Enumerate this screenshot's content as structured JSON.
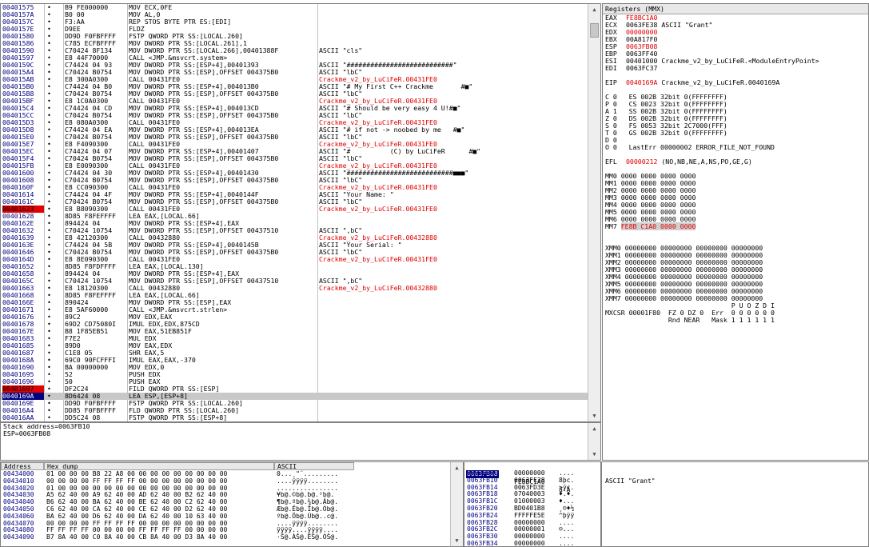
{
  "cpu": {
    "rows": [
      {
        "addr": "00401575",
        "hex": "B9 FE000000",
        "asm": "MOV ECX,0FE",
        "cmt": "",
        "cls": ""
      },
      {
        "addr": "0040157A",
        "hex": "B0 00",
        "asm": "MOV AL,0",
        "cmt": "",
        "cls": ""
      },
      {
        "addr": "0040157C",
        "hex": "F3:AA",
        "asm": "REP STOS BYTE PTR ES:[EDI]",
        "cmt": "",
        "cls": ""
      },
      {
        "addr": "0040157E",
        "hex": "D9EE",
        "asm": "FLDZ",
        "cmt": "",
        "cls": ""
      },
      {
        "addr": "00401580",
        "hex": "DD9D F0FBFFFF",
        "asm": "FSTP QWORD PTR SS:[LOCAL.260]",
        "cmt": "",
        "cls": ""
      },
      {
        "addr": "00401586",
        "hex": "C785 ECFBFFFF",
        "asm": "MOV DWORD PTR SS:[LOCAL.261],1",
        "cmt": "",
        "cls": ""
      },
      {
        "addr": "00401590",
        "hex": "C70424 8F134",
        "asm": "MOV DWORD PTR SS:[LOCAL.266],00401388F",
        "cmt": "ASCII \"cls\"",
        "cls": ""
      },
      {
        "addr": "00401597",
        "hex": "E8 44F70000",
        "asm": "CALL <JMP.&msvcrt.system>",
        "cmt": "",
        "cls": ""
      },
      {
        "addr": "0040159C",
        "hex": "C74424 04 93",
        "asm": "MOV DWORD PTR SS:[ESP+4],00401393",
        "cmt": "ASCII \"###########################\"",
        "cls": ""
      },
      {
        "addr": "004015A4",
        "hex": "C70424 B0754",
        "asm": "MOV DWORD PTR SS:[ESP],OFFSET 004375B0",
        "cmt": "ASCII \"lbC\"",
        "cls": ""
      },
      {
        "addr": "004015AB",
        "hex": "E8 300A0300",
        "asm": "CALL 00431FE0",
        "cmt": "Crackme_v2_by_LuCiFeR.00431FE0",
        "cls": "red"
      },
      {
        "addr": "004015B0",
        "hex": "C74424 04 B0",
        "asm": "MOV DWORD PTR SS:[ESP+4],004013B0",
        "cmt": "ASCII \"# My First C++ Crackme       #■\"",
        "cls": ""
      },
      {
        "addr": "004015B8",
        "hex": "C70424 B0754",
        "asm": "MOV DWORD PTR SS:[ESP],OFFSET 004375B0",
        "cmt": "ASCII \"lbC\"",
        "cls": ""
      },
      {
        "addr": "004015BF",
        "hex": "E8 1C0A0300",
        "asm": "CALL 00431FE0",
        "cmt": "Crackme_v2_by_LuCiFeR.00431FE0",
        "cls": "red"
      },
      {
        "addr": "004015C4",
        "hex": "C74424 04 CD",
        "asm": "MOV DWORD PTR SS:[ESP+4],004013CD",
        "cmt": "ASCII \"# Should be very easy 4 U!#■\"",
        "cls": ""
      },
      {
        "addr": "004015CC",
        "hex": "C70424 B0754",
        "asm": "MOV DWORD PTR SS:[ESP],OFFSET 004375B0",
        "cmt": "ASCII \"lbC\"",
        "cls": ""
      },
      {
        "addr": "004015D3",
        "hex": "E8 080A0300",
        "asm": "CALL 00431FE0",
        "cmt": "Crackme_v2_by_LuCiFeR.00431FE0",
        "cls": "red"
      },
      {
        "addr": "004015D8",
        "hex": "C74424 04 EA",
        "asm": "MOV DWORD PTR SS:[ESP+4],004013EA",
        "cmt": "ASCII \"# if not -> noobed by me   #■\"",
        "cls": ""
      },
      {
        "addr": "004015E0",
        "hex": "C70424 B0754",
        "asm": "MOV DWORD PTR SS:[ESP],OFFSET 004375B0",
        "cmt": "ASCII \"lbC\"",
        "cls": ""
      },
      {
        "addr": "004015E7",
        "hex": "E8 F4090300",
        "asm": "CALL 00431FE0",
        "cmt": "Crackme_v2_by_LuCiFeR.00431FE0",
        "cls": "red"
      },
      {
        "addr": "004015EC",
        "hex": "C74424 04 07",
        "asm": "MOV DWORD PTR SS:[ESP+4],00401407",
        "cmt": "ASCII \"#          (C) by LuCiFeR      #■\"",
        "cls": ""
      },
      {
        "addr": "004015F4",
        "hex": "C70424 B0754",
        "asm": "MOV DWORD PTR SS:[ESP],OFFSET 004375B0",
        "cmt": "ASCII \"lbC\"",
        "cls": ""
      },
      {
        "addr": "004015FB",
        "hex": "E8 E0090300",
        "asm": "CALL 00431FE0",
        "cmt": "Crackme_v2_by_LuCiFeR.00431FE0",
        "cls": "red"
      },
      {
        "addr": "00401600",
        "hex": "C74424 04 30",
        "asm": "MOV DWORD PTR SS:[ESP+4],00401430",
        "cmt": "ASCII \"###########################■■■\"",
        "cls": ""
      },
      {
        "addr": "00401608",
        "hex": "C70424 B0754",
        "asm": "MOV DWORD PTR SS:[ESP],OFFSET 004375B0",
        "cmt": "ASCII \"lbC\"",
        "cls": ""
      },
      {
        "addr": "0040160F",
        "hex": "E8 CC090300",
        "asm": "CALL 00431FE0",
        "cmt": "Crackme_v2_by_LuCiFeR.00431FE0",
        "cls": "red"
      },
      {
        "addr": "00401614",
        "hex": "C74424 04 4F",
        "asm": "MOV DWORD PTR SS:[ESP+4],0040144F",
        "cmt": "ASCII \"Your Name: \"",
        "cls": ""
      },
      {
        "addr": "0040161C",
        "hex": "C70424 B0754",
        "asm": "MOV DWORD PTR SS:[ESP],OFFSET 004375B0",
        "cmt": "ASCII \"lbC\"",
        "cls": ""
      },
      {
        "addr": "00401623",
        "hex": "E8 B8090300",
        "asm": "CALL 00431FE0",
        "cmt": "Crackme_v2_by_LuCiFeR.00431FE0",
        "cls": "red",
        "row": "bp"
      },
      {
        "addr": "00401628",
        "hex": "8D85 F8FEFFFF",
        "asm": "LEA EAX,[LOCAL.66]",
        "cmt": "",
        "cls": ""
      },
      {
        "addr": "0040162E",
        "hex": "894424 04",
        "asm": "MOV DWORD PTR SS:[ESP+4],EAX",
        "cmt": "",
        "cls": ""
      },
      {
        "addr": "00401632",
        "hex": "C70424 10754",
        "asm": "MOV DWORD PTR SS:[ESP],OFFSET 00437510",
        "cmt": "ASCII \",bC\"",
        "cls": ""
      },
      {
        "addr": "00401639",
        "hex": "E8 42120300",
        "asm": "CALL 00432880",
        "cmt": "Crackme_v2_by_LuCiFeR.00432880",
        "cls": "red"
      },
      {
        "addr": "0040163E",
        "hex": "C74424 04 5B",
        "asm": "MOV DWORD PTR SS:[ESP+4],0040145B",
        "cmt": "ASCII \"Your Serial: \"",
        "cls": ""
      },
      {
        "addr": "00401646",
        "hex": "C70424 B0754",
        "asm": "MOV DWORD PTR SS:[ESP],OFFSET 004375B0",
        "cmt": "ASCII \"lbC\"",
        "cls": ""
      },
      {
        "addr": "0040164D",
        "hex": "E8 8E090300",
        "asm": "CALL 00431FE0",
        "cmt": "Crackme_v2_by_LuCiFeR.00431FE0",
        "cls": "red"
      },
      {
        "addr": "00401652",
        "hex": "8D85 F8FDFFFF",
        "asm": "LEA EAX,[LOCAL.130]",
        "cmt": "",
        "cls": ""
      },
      {
        "addr": "00401658",
        "hex": "894424 04",
        "asm": "MOV DWORD PTR SS:[ESP+4],EAX",
        "cmt": "",
        "cls": ""
      },
      {
        "addr": "0040165C",
        "hex": "C70424 10754",
        "asm": "MOV DWORD PTR SS:[ESP],OFFSET 00437510",
        "cmt": "ASCII \",bC\"",
        "cls": ""
      },
      {
        "addr": "00401663",
        "hex": "E8 18120300",
        "asm": "CALL 00432880",
        "cmt": "Crackme_v2_by_LuCiFeR.00432880",
        "cls": "red"
      },
      {
        "addr": "00401668",
        "hex": "8D85 F8FEFFFF",
        "asm": "LEA EAX,[LOCAL.66]",
        "cmt": "",
        "cls": ""
      },
      {
        "addr": "0040166E",
        "hex": "890424",
        "asm": "MOV DWORD PTR SS:[ESP],EAX",
        "cmt": "",
        "cls": ""
      },
      {
        "addr": "00401671",
        "hex": "E8 5AF60000",
        "asm": "CALL <JMP.&msvcrt.strlen>",
        "cmt": "",
        "cls": ""
      },
      {
        "addr": "00401676",
        "hex": "89C2",
        "asm": "MOV EDX,EAX",
        "cmt": "",
        "cls": ""
      },
      {
        "addr": "00401678",
        "hex": "69D2 CD75080I",
        "asm": "IMUL EDX,EDX,875CD",
        "cmt": "",
        "cls": ""
      },
      {
        "addr": "0040167E",
        "hex": "B8 1F85EB51",
        "asm": "MOV EAX,51EB851F",
        "cmt": "",
        "cls": ""
      },
      {
        "addr": "00401683",
        "hex": "F7E2",
        "asm": "MUL EDX",
        "cmt": "",
        "cls": ""
      },
      {
        "addr": "00401685",
        "hex": "89D0",
        "asm": "MOV EAX,EDX",
        "cmt": "",
        "cls": ""
      },
      {
        "addr": "00401687",
        "hex": "C1E8 05",
        "asm": "SHR EAX,5",
        "cmt": "",
        "cls": ""
      },
      {
        "addr": "0040168A",
        "hex": "69C0 90FCFFFI",
        "asm": "IMUL EAX,EAX,-370",
        "cmt": "",
        "cls": ""
      },
      {
        "addr": "00401690",
        "hex": "BA 00000000",
        "asm": "MOV EDX,0",
        "cmt": "",
        "cls": ""
      },
      {
        "addr": "00401695",
        "hex": "52",
        "asm": "PUSH EDX",
        "cmt": "",
        "cls": ""
      },
      {
        "addr": "00401696",
        "hex": "50",
        "asm": "PUSH EAX",
        "cmt": "",
        "cls": ""
      },
      {
        "addr": "00401697",
        "hex": "DF2C24",
        "asm": "FILD QWORD PTR SS:[ESP]",
        "cmt": "",
        "cls": "",
        "row": "bp"
      },
      {
        "addr": "0040169A",
        "hex": "8D6424 08",
        "asm": "LEA ESP,[ESP+8]",
        "cmt": "",
        "cls": "",
        "row": "eip"
      },
      {
        "addr": "0040169E",
        "hex": "DD9D F0FBFFFF",
        "asm": "FSTP QWORD PTR SS:[LOCAL.260]",
        "cmt": "",
        "cls": ""
      },
      {
        "addr": "004016A4",
        "hex": "DD85 F0FBFFFF",
        "asm": "FLD QWORD PTR SS:[LOCAL.260]",
        "cmt": "",
        "cls": ""
      },
      {
        "addr": "004016AA",
        "hex": "DD5C24 08",
        "asm": "FSTP QWORD PTR SS:[ESP+8]",
        "cmt": "",
        "cls": ""
      }
    ]
  },
  "info": {
    "line1": "Stack address=0063FB10",
    "line2": "ESP=0063FB08"
  },
  "registers": {
    "title": "Registers (MMX)",
    "lines": [
      {
        "n": "EAX",
        "v": "FE8BC1A0",
        "d": "",
        "chg": true
      },
      {
        "n": "ECX",
        "v": "0063FE38",
        "d": "ASCII \"Grant\"",
        "chg": false
      },
      {
        "n": "EDX",
        "v": "00000000",
        "d": "",
        "chg": true
      },
      {
        "n": "EBX",
        "v": "00A817F0",
        "d": "",
        "chg": false
      },
      {
        "n": "ESP",
        "v": "0063FB08",
        "d": "",
        "chg": true
      },
      {
        "n": "EBP",
        "v": "0063FF40",
        "d": "",
        "chg": false
      },
      {
        "n": "ESI",
        "v": "00401000",
        "d": "Crackme_v2_by_LuCiFeR.<ModuleEntryPoint>",
        "chg": false
      },
      {
        "n": "EDI",
        "v": "0063FC37",
        "d": "",
        "chg": false
      }
    ],
    "eip": {
      "n": "EIP",
      "v": "0040169A",
      "d": "Crackme_v2_by_LuCiFeR.0040169A"
    },
    "flags": [
      "C 0   ES 002B 32bit 0(FFFFFFFF)",
      "P 0   CS 0023 32bit 0(FFFFFFFF)",
      "A 1   SS 002B 32bit 0(FFFFFFFF)",
      "Z 0   DS 002B 32bit 0(FFFFFFFF)",
      "S 0   FS 0053 32bit 2C7000(FFF)",
      "T 0   GS 002B 32bit 0(FFFFFFFF)",
      "D 0",
      "O 0   LastErr 00000002 ERROR_FILE_NOT_FOUND"
    ],
    "efl": {
      "n": "EFL",
      "v": "00000212",
      "d": "(NO,NB,NE,A,NS,PO,GE,G)"
    },
    "mm": [
      "MM0 0000 0000 0000 0000",
      "MM1 0000 0000 0000 0000",
      "MM2 0000 0000 0000 0000",
      "MM3 0000 0000 0000 0000",
      "MM4 0000 0000 0000 0000",
      "MM5 0000 0000 0000 0000",
      "MM6 0000 0000 0000 0000"
    ],
    "mm7": {
      "n": "MM7",
      "v": "FE8B C1A0 0000 0000"
    },
    "xmm": [
      "XMM0 00000000 00000000 00000000 00000000",
      "XMM1 00000000 00000000 00000000 00000000",
      "XMM2 00000000 00000000 00000000 00000000",
      "XMM3 00000000 00000000 00000000 00000000",
      "XMM4 00000000 00000000 00000000 00000000",
      "XMM5 00000000 00000000 00000000 00000000",
      "XMM6 00000000 00000000 00000000 00000000",
      "XMM7 00000000 00000000 00000000 00000000"
    ],
    "mxcsr": [
      "                                P U O Z D I",
      "MXCSR 00001F80  FZ 0 DZ 0  Err  0 0 0 0 0 0",
      "                Rnd NEAR   Mask 1 1 1 1 1 1"
    ]
  },
  "dump": {
    "header_addr": "Address",
    "header_hex": "Hex dump",
    "header_ascii": "ASCII",
    "rows": [
      {
        "a": "00434000",
        "h": "01 00 00 00 B8 22 A8 00 00 00 00 00 00 00 00 00",
        "s": "0...¸\"¨........."
      },
      {
        "a": "00434010",
        "h": "00 00 00 00 FF FF FF FF 00 00 00 00 00 00 00 00",
        "s": "....ÿÿÿÿ........"
      },
      {
        "a": "00434020",
        "h": "01 00 00 00 00 00 00 00 00 00 00 00 00 00 00 00",
        "s": "................"
      },
      {
        "a": "00434030",
        "h": "A5 62 40 00 A9 62 40 00 AD 62 40 00 B2 62 40 00",
        "s": "¥b@.©b@.­b@.²b@."
      },
      {
        "a": "00434040",
        "h": "B6 62 40 00 BA 62 40 00 BE 62 40 00 C2 62 40 00",
        "s": "¶b@.ºb@.¾b@.Âb@."
      },
      {
        "a": "00434050",
        "h": "C6 62 40 00 CA 62 40 00 CE 62 40 00 D2 62 40 00",
        "s": "Æb@.Êb@.Îb@.Òb@."
      },
      {
        "a": "00434060",
        "h": "BA 62 40 00 D6 62 40 00 DA 62 40 00 10 63 40 00",
        "s": "ºb@.Öb@.Úb@..c@."
      },
      {
        "a": "00434070",
        "h": "00 00 00 00 FF FF FF FF 00 00 00 00 00 00 00 00",
        "s": "....ÿÿÿÿ........"
      },
      {
        "a": "00434080",
        "h": "FF FF FF FF 00 00 00 00 FF FF FF FF 00 00 00 00",
        "s": "ÿÿÿÿ....ÿÿÿÿ...."
      },
      {
        "a": "00434090",
        "h": "B7 8A 40 00 C0 8A 40 00 CB 8A 40 00 D3 8A 40 00",
        "s": "·Š@.ÀŠ@.ËŠ@.ÓŠ@."
      }
    ]
  },
  "stack": {
    "header_addr": "0063FB08",
    "header_val": "FE8BC1A0",
    "header_ascii": "â‹Á",
    "rows": [
      {
        "a": "0063FB0C",
        "v": "00000000",
        "s": "...."
      },
      {
        "a": "0063FB10",
        "v": "0063FE38",
        "s": "8þc."
      },
      {
        "a": "0063FB14",
        "v": "0063FD3E",
        "s": ">ýc."
      },
      {
        "a": "0063FB18",
        "v": "07040003",
        "s": "♦.♦."
      },
      {
        "a": "0063FB1C",
        "v": "01000003",
        "s": "♦..."
      },
      {
        "a": "0063FB20",
        "v": "BD0401B8",
        "s": "¸☺♦½"
      },
      {
        "a": "0063FB24",
        "v": "FFFFFE5E",
        "s": "^þÿÿ"
      },
      {
        "a": "0063FB28",
        "v": "00000000",
        "s": "...."
      },
      {
        "a": "0063FB2C",
        "v": "00000001",
        "s": "☺..."
      },
      {
        "a": "0063FB30",
        "v": "00000000",
        "s": "...."
      },
      {
        "a": "0063FB34",
        "v": "00000000",
        "s": "...."
      }
    ]
  },
  "stack_comment": "ASCII \"Grant\""
}
